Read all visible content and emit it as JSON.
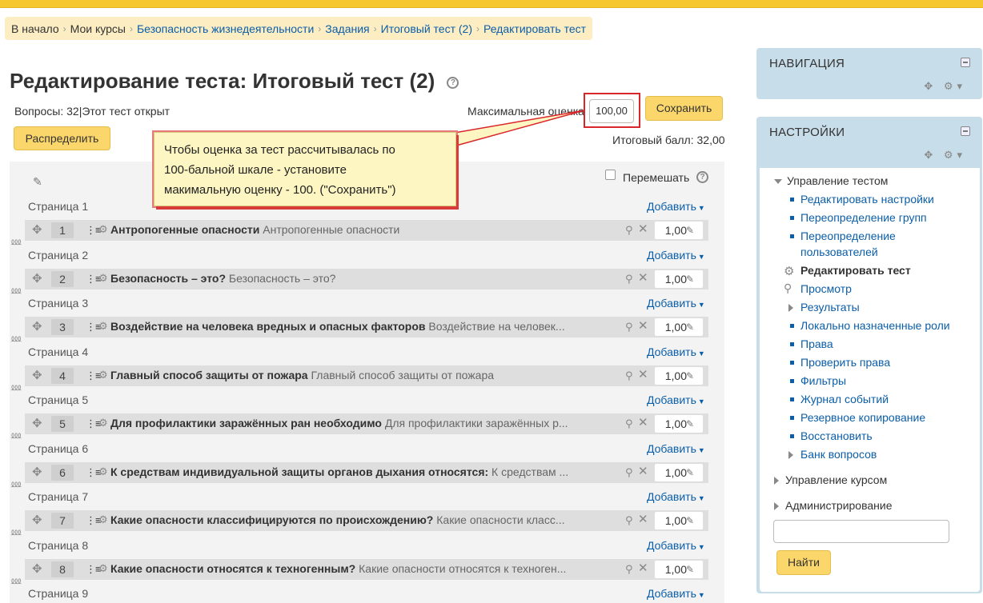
{
  "breadcrumb": {
    "items": [
      "В начало",
      "Мои курсы",
      "Безопасность жизнедеятельности",
      "Задания",
      "Итоговый тест (2)",
      "Редактировать тест"
    ],
    "separator": "›"
  },
  "header": {
    "title": "Редактирование теста: Итоговый тест (2)",
    "help": "?"
  },
  "quiz_info": {
    "questions_prefix": "Вопросы: ",
    "questions_count": "32",
    "status": "|Этот тест открыт",
    "max_grade_label": "Максимальная оценка",
    "max_grade_value": "100,00",
    "save_label": "Сохранить",
    "distribute_label": "Распределить",
    "total_grade": "Итоговый балл: 32,00"
  },
  "callout": {
    "lines": [
      "Чтобы оценка за тест рассчитывалась по",
      "100-бальной шкале - установите",
      "макимальную оценку - 100. (\"Сохранить\")"
    ],
    "border_color": "#d9262a"
  },
  "editing": {
    "shuffle_label": "Перемешать",
    "add_label": "Добавить",
    "pages": [
      {
        "page": "Страница 1",
        "num": "1",
        "name": "Антропогенные опасности",
        "text": "Антропогенные опасности",
        "mark": "1,00"
      },
      {
        "page": "Страница 2",
        "num": "2",
        "name": "Безопасность – это?",
        "text": "Безопасность – это?",
        "mark": "1,00"
      },
      {
        "page": "Страница 3",
        "num": "3",
        "name": "Воздействие на человека вредных и опасных факторов",
        "text": "Воздействие на человек...",
        "mark": "1,00"
      },
      {
        "page": "Страница 4",
        "num": "4",
        "name": "Главный способ защиты от пожара",
        "text": "Главный способ защиты от пожара",
        "mark": "1,00"
      },
      {
        "page": "Страница 5",
        "num": "5",
        "name": "Для профилактики заражённых ран необходимо",
        "text": "Для профилактики заражённых р...",
        "mark": "1,00"
      },
      {
        "page": "Страница 6",
        "num": "6",
        "name": "К средствам индивидуальной защиты органов дыхания относятся:",
        "text": "К средствам ...",
        "mark": "1,00"
      },
      {
        "page": "Страница 7",
        "num": "7",
        "name": "Какие опасности классифицируются по происхождению?",
        "text": "Какие опасности класс...",
        "mark": "1,00"
      },
      {
        "page": "Страница 8",
        "num": "8",
        "name": "Какие опасности относятся к техногенным?",
        "text": "Какие опасности относятся к техноген...",
        "mark": "1,00"
      }
    ],
    "last_page": "Страница 9"
  },
  "sidebar": {
    "navigation_title": "НАВИГАЦИЯ",
    "settings_title": "НАСТРОЙКИ",
    "quiz_admin": "Управление тестом",
    "items": [
      "Редактировать настройки",
      "Переопределение групп",
      "Переопределение",
      "пользователей",
      "Редактировать тест",
      "Просмотр",
      "Результаты",
      "Локально назначенные роли",
      "Права",
      "Проверить права",
      "Фильтры",
      "Журнал событий",
      "Резервное копирование",
      "Восстановить",
      "Банк вопросов"
    ],
    "course_admin": "Управление курсом",
    "site_admin": "Администрирование",
    "search_value": "",
    "find_label": "Найти"
  },
  "colors": {
    "topbar": "#f7c730",
    "breadcrumb_bg": "#fcedc3",
    "link": "#0b5ea8",
    "button": "#fbd66a",
    "block_header": "#c7dde9",
    "callout_bg": "#fef6c2"
  },
  "icons": [
    "help-icon",
    "pencil-icon",
    "move-icon",
    "question-type-icon",
    "gear-icon",
    "preview-icon",
    "delete-icon",
    "edit-mark-icon",
    "page-split-icon",
    "dock-icon",
    "settings-menu-icon"
  ]
}
